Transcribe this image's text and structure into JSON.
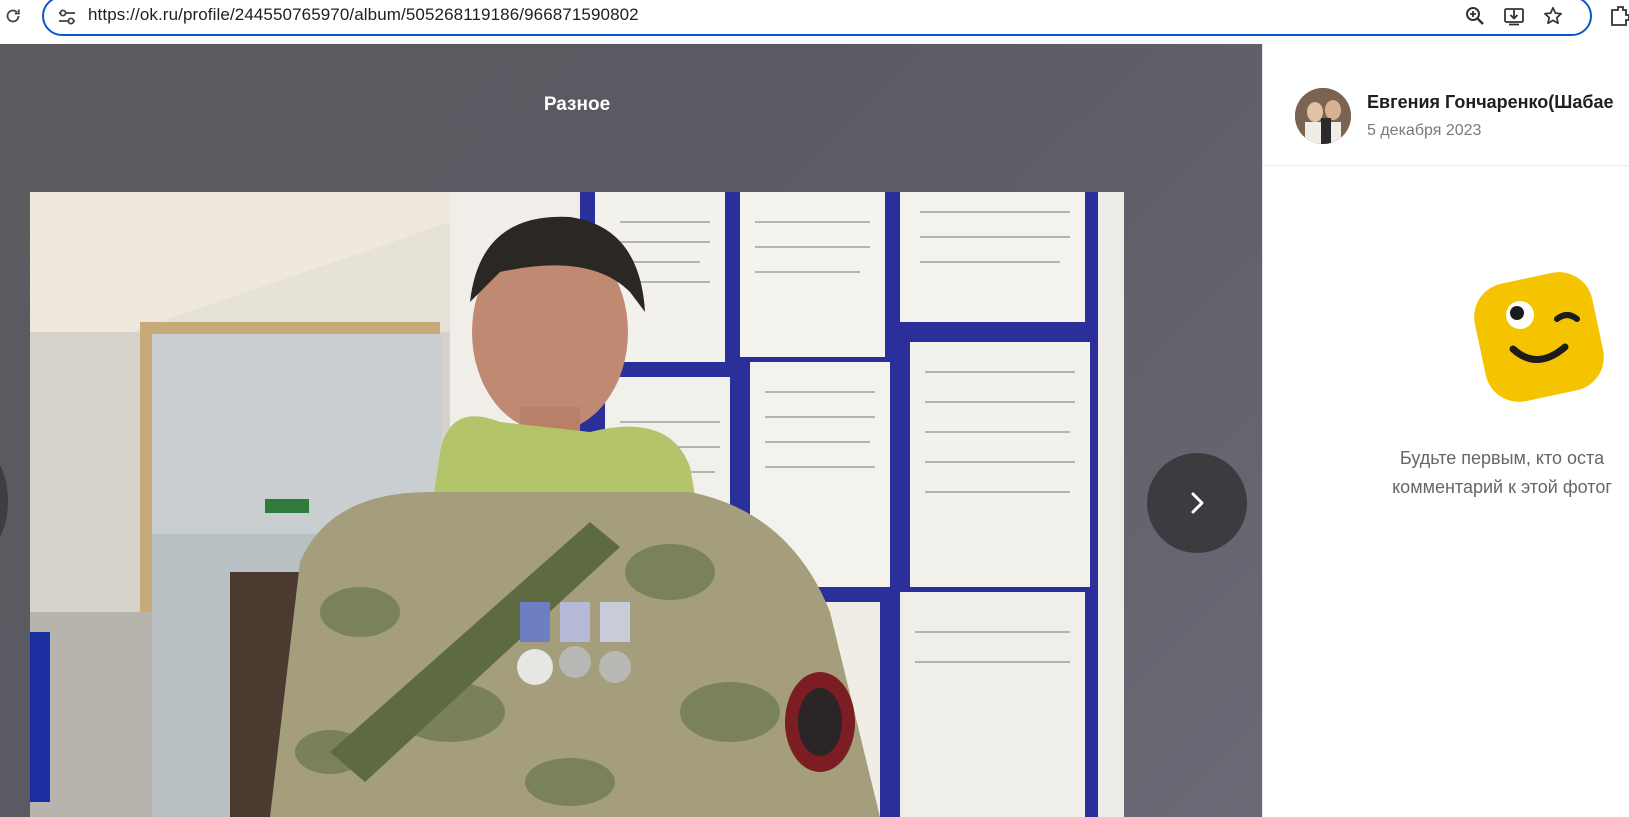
{
  "browser": {
    "url": "https://ok.ru/profile/244550765970/album/505268119186/966871590802",
    "icons": [
      "reload-icon",
      "site-info-icon",
      "zoom-icon",
      "install-app-icon",
      "bookmark-star-icon",
      "extensions-icon"
    ]
  },
  "viewer": {
    "album_title": "Разное",
    "photo_description": "photo",
    "next_icon": "chevron-right-icon",
    "prev_icon": "chevron-left-icon"
  },
  "side_panel": {
    "author_name": "Евгения Гончаренко(Шабае",
    "post_date": "5 декабря 2023",
    "empty_line1": "Будьте первым, кто оста",
    "empty_line2": "комментарий к этой фотог",
    "mascot_icon": "winking-face-icon"
  },
  "colors": {
    "omnibox_border": "#0b57d0",
    "viewer_bg": "#5e5e66",
    "arrow_bg": "#3c3c40",
    "mascot_yellow": "#f5c400"
  }
}
